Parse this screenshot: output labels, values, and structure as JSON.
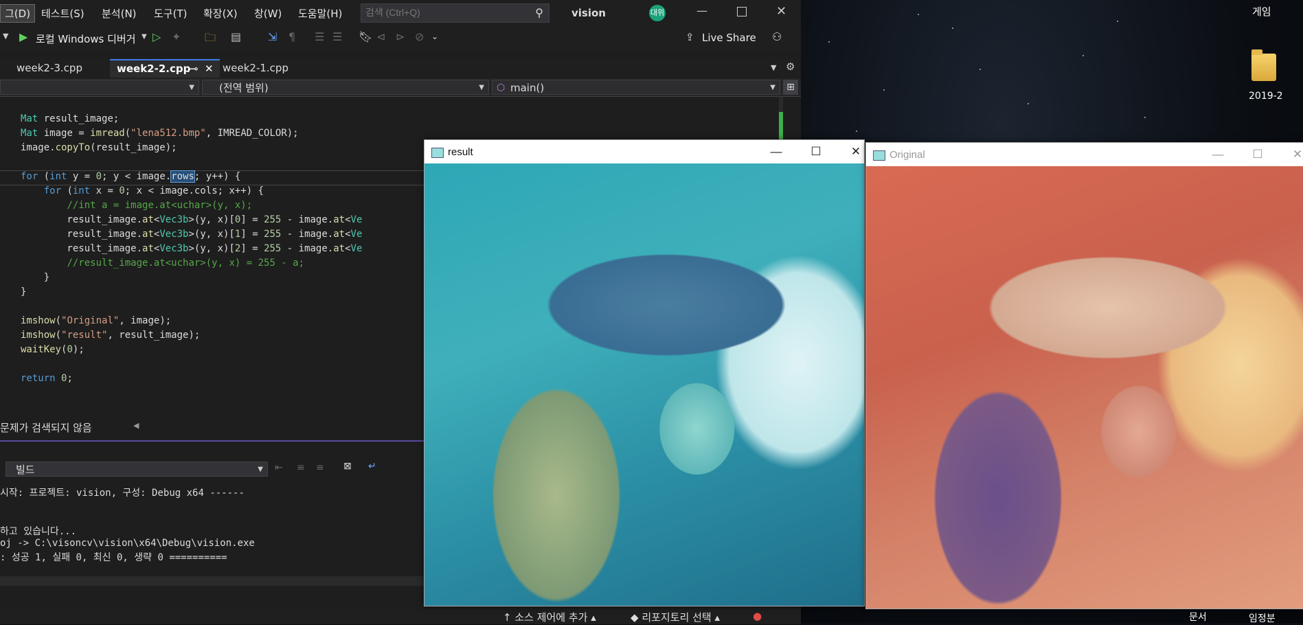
{
  "vs": {
    "menus": [
      "그(D)",
      "테스트(S)",
      "분석(N)",
      "도구(T)",
      "확장(X)",
      "창(W)",
      "도움말(H)"
    ],
    "search_placeholder": "검색 (Ctrl+Q)",
    "solution_name": "vision",
    "user_initials": "대위",
    "toolbar": {
      "run_label": "로컬 Windows 디버거",
      "live_share": "Live Share"
    },
    "tabs": [
      "week2-3.cpp",
      "week2-2.cpp",
      "week2-1.cpp"
    ],
    "nav": {
      "scope": "(전역 범위)",
      "function": "main()"
    },
    "code_lines": [
      "Mat result_image;",
      "Mat image = imread(\"lena512.bmp\", IMREAD_COLOR);",
      "image.copyTo(result_image);",
      "",
      "for (int y = 0; y < image.rows; y++) {",
      "    for (int x = 0; x < image.cols; x++) {",
      "        //int a = image.at<uchar>(y, x);",
      "        result_image.at<Vec3b>(y, x)[0] = 255 - image.at<Ve",
      "        result_image.at<Vec3b>(y, x)[1] = 255 - image.at<Ve",
      "        result_image.at<Vec3b>(y, x)[2] = 255 - image.at<Ve",
      "        //result_image.at<uchar>(y, x) = 255 - a;",
      "    }",
      "}",
      "",
      "imshow(\"Original\", image);",
      "imshow(\"result\", result_image);",
      "waitKey(0);",
      "",
      "return 0;"
    ],
    "issues_status": "문제가 검색되지 않음",
    "output": {
      "source": "빌드",
      "lines": [
        "시작: 프로젝트: vision, 구성: Debug x64 ------",
        "",
        "",
        "하고 있습니다...",
        "oj -> C:\\visoncv\\vision\\x64\\Debug\\vision.exe",
        ": 성공 1, 실패 0, 최신 0, 생략 0 =========="
      ]
    },
    "bottom": {
      "add_source_control": "소스 제어에 추가",
      "select_repo": "리포지토리 선택"
    }
  },
  "windows": {
    "result_title": "result",
    "original_title": "Original"
  },
  "desktop": {
    "game_label": "게임",
    "folder_label": "2019-2",
    "bottom_label_1": "문서",
    "bottom_label_2": "임정분"
  }
}
